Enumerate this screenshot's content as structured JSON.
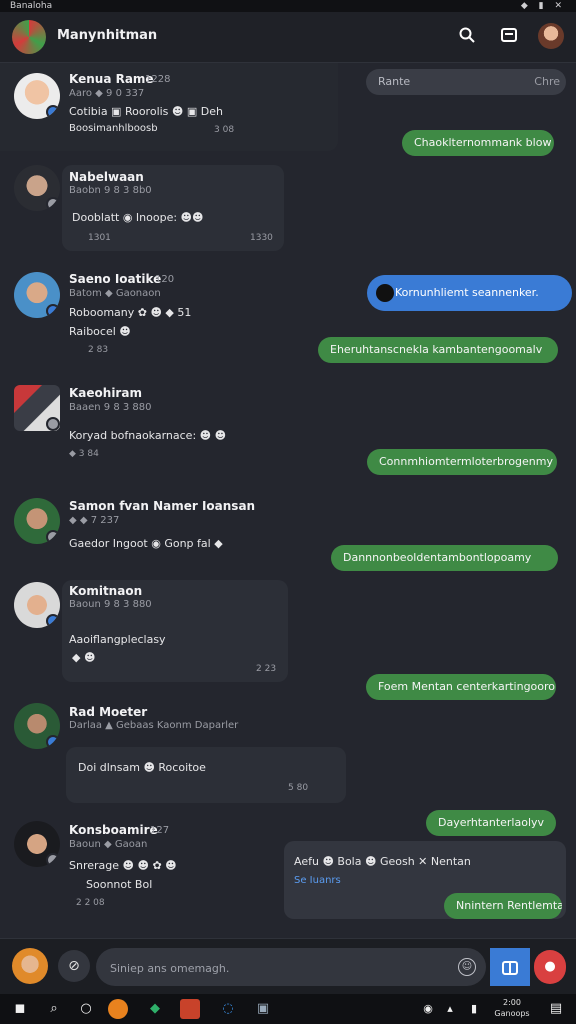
{
  "status_bar": {
    "left_text": "Banaloha",
    "right_icons": "◆ ▮ ✕"
  },
  "header": {
    "title": "Manynhitman"
  },
  "colors": {
    "accent_blue": "#3a7bd5",
    "bubble_green": "#3f8a45",
    "card": "#2c2f37",
    "background": "#24262e"
  },
  "top_search": {
    "placeholder": "Rante",
    "right": "Chre"
  },
  "posts": [
    {
      "name": "Kenua Rame",
      "handle": "1228",
      "meta": "Aaro ◆ 9 0 337",
      "text": "Cotibia ▣ Roorolis ☻ ▣ Deh",
      "footer": "Boosimanhlboosb",
      "time": "3 08"
    },
    {
      "name": "Nabelwaan",
      "meta": "Baobn 9 8 3 8b0",
      "text": "Dooblatt ◉ Inoope: ☻☻",
      "footer": "1301",
      "time": "1330"
    },
    {
      "name": "Saeno Ioatike",
      "handle": "120",
      "meta": "Batom ◆ Gaonaon",
      "text": "Roboomany ✿ ☻ ◆ 51",
      "footer": "Raibocel ☻",
      "time": "2 83"
    },
    {
      "name": "Kaeohiram",
      "meta": "Baaen 9 8 3 880",
      "text": "Koryad bofnaokarnace: ☻ ☻",
      "footer": "◆ 3 84",
      "time": ""
    },
    {
      "name": "Samon fvan Namer Ioansan",
      "meta": "◆ ◆ 7 237",
      "text": "Gaedor Ingoot ◉ Gonp fal ◆",
      "footer": "",
      "time": ""
    },
    {
      "name": "Komitnaon",
      "meta": "Baoun 9 8 3 880",
      "text": "Aaoiflangpleclasy",
      "footer": "◆ ☻",
      "time": "2 23"
    },
    {
      "name": "Rad Moeter",
      "meta": "Darlaa ▲ Gebaas Kaonm Daparler",
      "text": "Doi dlnsam ☻ Rocoitoe",
      "footer": "",
      "time": "5 80"
    },
    {
      "name": "Konsboamire",
      "handle": "127",
      "meta": "Baoun ◆ Gaoan",
      "text": "Snrerage ☻ ☻ ✿ ☻",
      "footer": "Soonnot Bol",
      "time": "2 2 08"
    }
  ],
  "bubbles": [
    {
      "text": "Chaoklternommank blow"
    },
    {
      "text": "Kornunhliemt seannenker."
    },
    {
      "text": "Eheruhtanscnekla kambantengoomalv"
    },
    {
      "text": "Connmhiomtermloterbrogenmy"
    },
    {
      "text": "Dannnonbeoldentambontlopoamy"
    },
    {
      "text": "Foem Mentan centerkartingoorom"
    },
    {
      "text": "Dayerhtanterlaolyv"
    },
    {
      "text": "Nnintern Rentlemtaen"
    }
  ],
  "quote_card": {
    "line1": "Aefu ☻ Bola ☻ Geosh ✕ Nentan",
    "line2": "Se Iuanrs"
  },
  "composer": {
    "placeholder": "Siniep ans omemagh."
  },
  "taskbar": {
    "clock": "2:00",
    "date": "Ganoops"
  }
}
